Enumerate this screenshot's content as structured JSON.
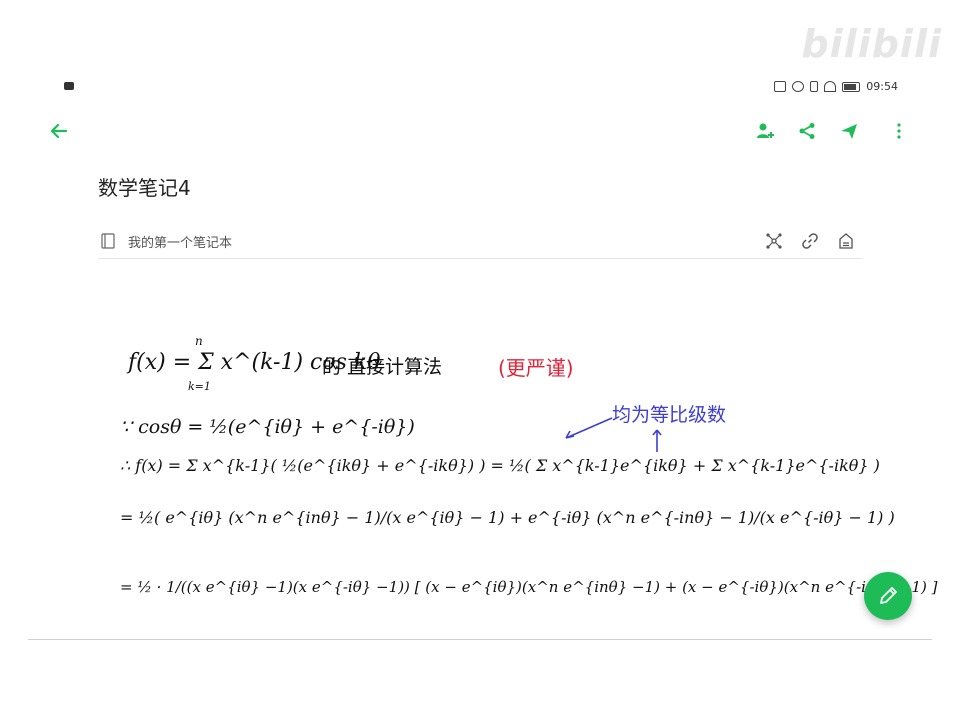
{
  "watermark": "bilibili",
  "status": {
    "time": "09:54"
  },
  "note": {
    "title": "数学笔记4",
    "notebook": "我的第一个笔记本"
  },
  "content": {
    "line1_formula": "f(x) = Σ x^(k-1) cos kθ",
    "line1_sum_top": "n",
    "line1_sum_bottom": "k=1",
    "line1_text": "的 直接计算法",
    "line1_red": "(更严谨)",
    "blue_note": "均为等比级数",
    "line2": "∵ cosθ = ½(e^{iθ} + e^{-iθ})",
    "line3": "∴ f(x) = Σ x^{k-1}( ½(e^{ikθ} + e^{-ikθ}) ) = ½( Σ x^{k-1}e^{ikθ} + Σ x^{k-1}e^{-ikθ} )",
    "line4": "= ½( e^{iθ} (x^n e^{inθ} − 1)/(x e^{iθ} − 1) + e^{-iθ} (x^n e^{-inθ} − 1)/(x e^{-iθ} − 1) )",
    "line5": "= ½ · 1/((x e^{iθ} −1)(x e^{-iθ} −1)) [ (x − e^{iθ})(x^n e^{inθ} −1) + (x − e^{-iθ})(x^n e^{-inθ} −1) ]"
  },
  "colors": {
    "accent": "#1ebc57",
    "red_ink": "#e0243a",
    "blue_ink": "#3d3fd1"
  },
  "icons": {
    "back": "arrow-left-icon",
    "add_user": "add-user-icon",
    "share": "share-icon",
    "send": "send-icon",
    "more": "more-vertical-icon",
    "notebook": "notebook-icon",
    "mindmap": "mindmap-icon",
    "link": "link-icon",
    "export": "export-icon",
    "edit": "pencil-icon"
  }
}
